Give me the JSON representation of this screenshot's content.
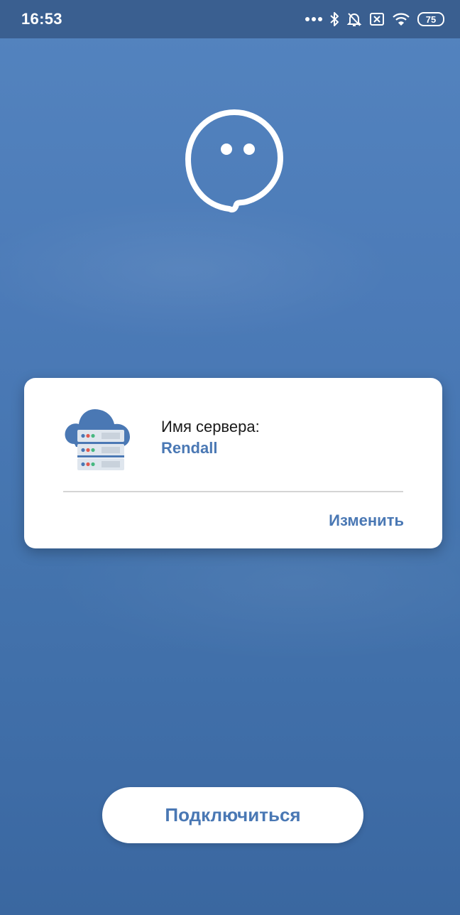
{
  "status_bar": {
    "time": "16:53",
    "icons": [
      "more-dots-icon",
      "bluetooth-icon",
      "bell-off-icon",
      "sim-x-icon",
      "wifi-icon"
    ],
    "battery_level": "75"
  },
  "server_card": {
    "label": "Имя сервера:",
    "server_name": "Rendall",
    "change_label": "Изменить"
  },
  "connect_button": {
    "label": "Подключиться"
  },
  "colors": {
    "background": "#4a78b4",
    "accent": "#4a78b4",
    "card": "#ffffff"
  }
}
